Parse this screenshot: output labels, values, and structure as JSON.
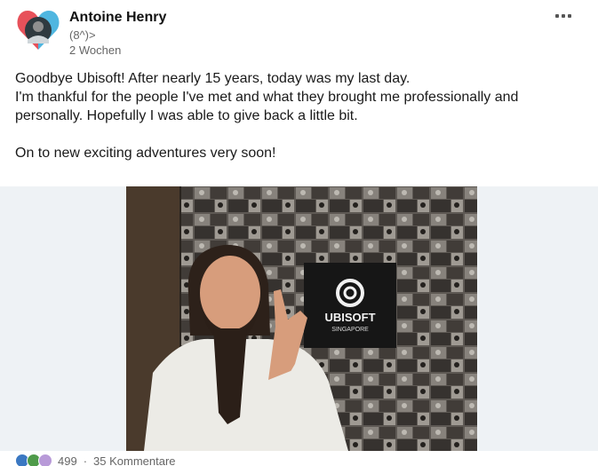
{
  "author": {
    "name": "Antoine Henry",
    "headline": "(8^)>",
    "time": "2 Wochen"
  },
  "post": {
    "lines": [
      "Goodbye Ubisoft! After nearly 15 years, today was my last day.",
      "I'm thankful for the people I've met and what they brought me professionally and",
      "personally. Hopefully I was able to give back a little bit.",
      "On to new exciting adventures very soon!"
    ]
  },
  "image": {
    "sign_brand": "UBISOFT",
    "sign_location": "SINGAPORE"
  },
  "social": {
    "reaction_count": "499",
    "separator": "·",
    "comments": "35 Kommentare"
  },
  "icons": {
    "more": "more-options-icon",
    "reactions": [
      "like-icon",
      "celebrate-icon",
      "love-icon"
    ]
  },
  "colors": {
    "media_background": "#eef2f5",
    "sign_background": "#161616",
    "avatar_heart_left": "#e7515a",
    "avatar_heart_right": "#4fb6e0"
  }
}
